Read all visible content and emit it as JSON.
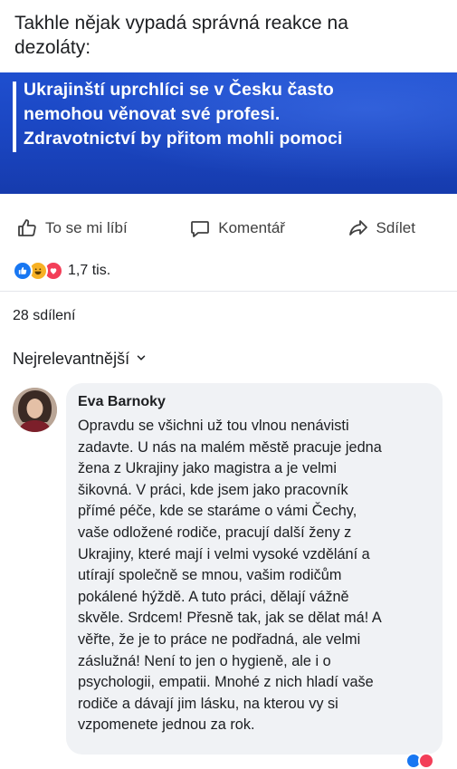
{
  "post": {
    "caption_lines": [
      "Takhle nějak vypadá správná reakce na",
      "dezoláty:"
    ]
  },
  "link_preview": {
    "headline_lines": [
      "Ukrajinští uprchlíci se v Česku často",
      "nemohou věnovat své profesi.",
      "Zdravotnictví by přitom mohli pomoci"
    ]
  },
  "actions": {
    "like_label": "To se mi líbí",
    "comment_label": "Komentář",
    "share_label": "Sdílet"
  },
  "reactions": {
    "icons": [
      "like-icon",
      "haha-icon",
      "love-icon"
    ],
    "count": "1,7 tis."
  },
  "shares": {
    "text": "28 sdílení"
  },
  "comments": {
    "sort_label": "Nejrelevantnější",
    "items": [
      {
        "author": "Eva Barnoky",
        "text_lines": [
          "Opravdu se všichni už tou vlnou nenávisti",
          "zadavte. U nás na malém městě pracuje jedna",
          "žena z Ukrajiny jako magistra a je velmi",
          "šikovná. V práci, kde jsem jako pracovník",
          "přímé péče, kde se staráme o vámi Čechy,",
          "vaše odložené rodiče, pracují další ženy z",
          "Ukrajiny, které mají i velmi vysoké vzdělání a",
          "utírají společně se mnou, vašim rodičům",
          "pokálené hýždě. A tuto práci, dělají vážně",
          "skvěle. Srdcem! Přesně tak, jak se dělat má! A",
          "věřte, že je to práce ne podřadná, ale velmi",
          "záslužná! Není to jen o hygieně, ale i o",
          "psychologii, empatii. Mnohé z nich hladí vaše",
          "rodiče a dávají jim lásku, na kterou vy si",
          "vzpomenete jednou za rok."
        ]
      }
    ]
  },
  "colors": {
    "facebook_blue": "#1877f2",
    "headline_background": "#1a45c0",
    "comment_bubble": "#f0f2f5"
  }
}
